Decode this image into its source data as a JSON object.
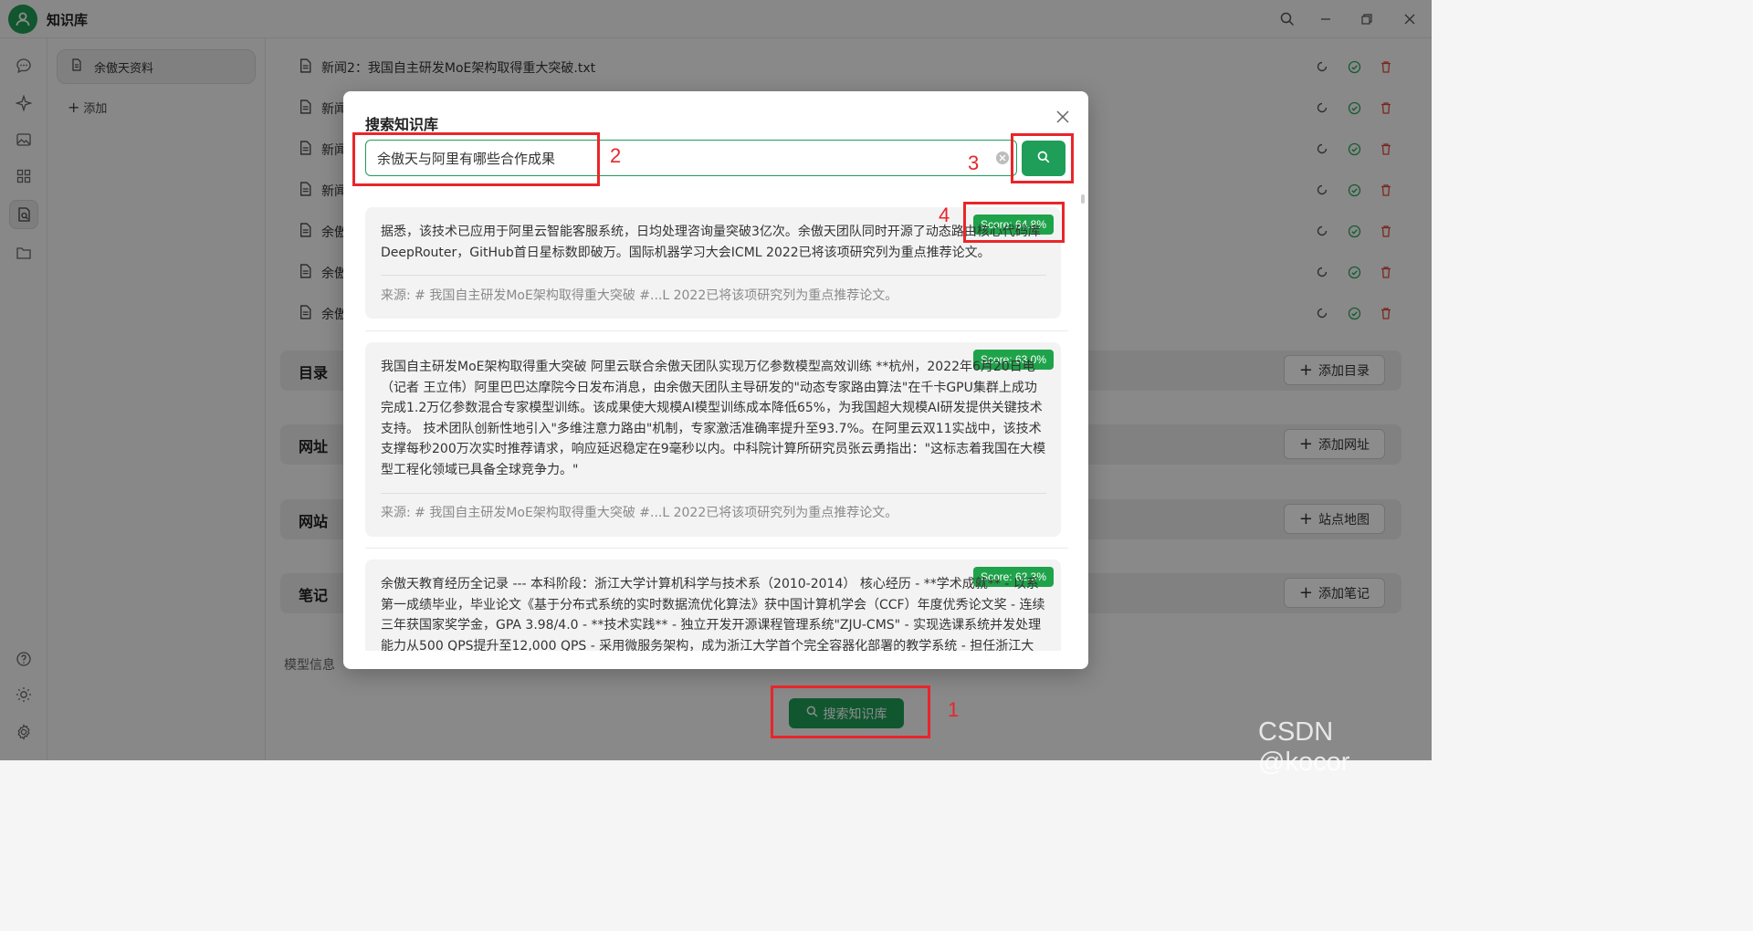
{
  "app": {
    "title": "知识库"
  },
  "sidebar": {
    "kb_name": "余傲天资料",
    "add_label": "添加"
  },
  "files": [
    {
      "name": "新闻2：我国自主研发MoE架构取得重大突破.txt"
    },
    {
      "name": "新闻"
    },
    {
      "name": "新闻"
    },
    {
      "name": "新闻"
    },
    {
      "name": "余傲"
    },
    {
      "name": "余傲"
    },
    {
      "name": "余傲"
    }
  ],
  "sections": {
    "directory": {
      "title": "目录",
      "button": "添加目录"
    },
    "url": {
      "title": "网址",
      "button": "添加网址"
    },
    "website": {
      "title": "网站",
      "button": "站点地图"
    },
    "notes": {
      "title": "笔记",
      "button": "添加笔记"
    }
  },
  "model_info_label": "模型信息",
  "search_button_label": "搜索知识库",
  "modal": {
    "title": "搜索知识库",
    "query": "余傲天与阿里有哪些合作成果",
    "results": [
      {
        "score": "Score: 64.8%",
        "text": "据悉，该技术已应用于阿里云智能客服系统，日均处理咨询量突破3亿次。余傲天团队同时开源了动态路由核心代码库DeepRouter，GitHub首日星标数即破万。国际机器学习大会ICML 2022已将该项研究列为重点推荐论文。",
        "source": "来源: # 我国自主研发MoE架构取得重大突破 #...L 2022已将该项研究列为重点推荐论文。"
      },
      {
        "score": "Score: 63.0%",
        "text": "我国自主研发MoE架构取得重大突破 阿里云联合余傲天团队实现万亿参数模型高效训练 **杭州，2022年6月20日电（记者 王立伟）阿里巴巴达摩院今日发布消息，由余傲天团队主导研发的\"动态专家路由算法\"在千卡GPU集群上成功完成1.2万亿参数混合专家模型训练。该成果使大规模AI模型训练成本降低65%，为我国超大规模AI研发提供关键技术支持。 技术团队创新性地引入\"多维注意力路由\"机制，专家激活准确率提升至93.7%。在阿里云双11实战中，该技术支撑每秒200万次实时推荐请求，响应延迟稳定在9毫秒以内。中科院计算所研究员张云勇指出：\"这标志着我国在大模型工程化领域已具备全球竞争力。\"",
        "source": "来源: # 我国自主研发MoE架构取得重大突破 #...L 2022已将该项研究列为重点推荐论文。"
      },
      {
        "score": "Score: 62.3%",
        "text": "余傲天教育经历全记录 --- 本科阶段：浙江大学计算机科学与技术系（2010-2014） 核心经历 - **学术成就** - 以系第一成绩毕业，毕业论文《基于分布式系统的实时数据流优化算法》获中国计算机学会（CCF）年度优秀论文奖 - 连续三年获国家奖学金，GPA 3.98/4.0 - **技术实践** - 独立开发开源课程管理系统\"ZJU-CMS\" - 实现选课系统并发处理能力从500 QPS提升至12,000 QPS - 采用微服务架构，成为浙江大学首个完全容器化部署的教学系统 - 担任浙江大"
      }
    ]
  },
  "annotations": [
    "1",
    "2",
    "3",
    "4"
  ],
  "watermark": "CSDN @kocor",
  "colors": {
    "accent": "#1e9e58",
    "score_badge": "#1fa34a",
    "annotation": "#e8262a"
  }
}
